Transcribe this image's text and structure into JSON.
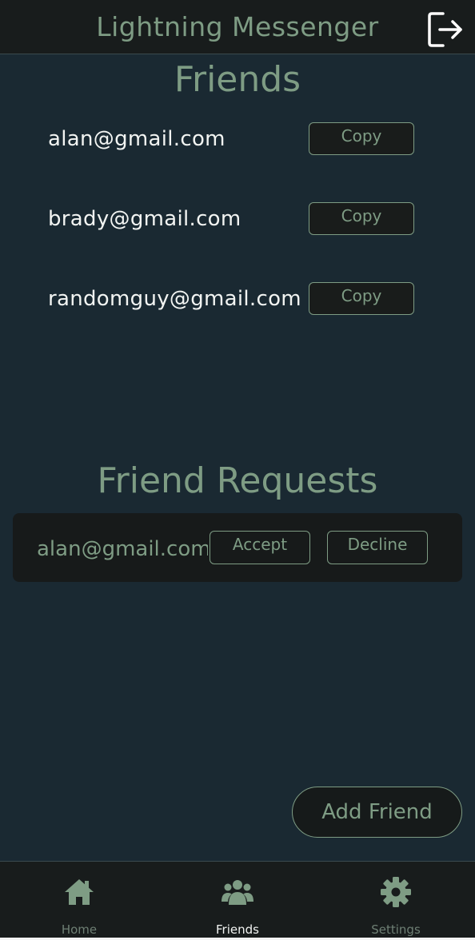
{
  "header": {
    "title": "Lightning Messenger",
    "logout_icon": "logout-icon"
  },
  "friends": {
    "title": "Friends",
    "items": [
      {
        "email": "alan@gmail.com",
        "copy_label": "Copy"
      },
      {
        "email": "brady@gmail.com",
        "copy_label": "Copy"
      },
      {
        "email": "randomguy@gmail.com",
        "copy_label": "Copy"
      }
    ]
  },
  "requests": {
    "title": "Friend Requests",
    "items": [
      {
        "email": "alan@gmail.com",
        "accept_label": "Accept",
        "decline_label": "Decline"
      }
    ]
  },
  "add_friend_label": "Add Friend",
  "tabs": [
    {
      "label": "Home",
      "icon": "home-icon",
      "active": false
    },
    {
      "label": "Friends",
      "icon": "users-icon",
      "active": true
    },
    {
      "label": "Settings",
      "icon": "gear-icon",
      "active": false
    }
  ],
  "colors": {
    "background": "#1a2932",
    "bar": "#181c1c",
    "accent": "#7e9c84",
    "text": "#f2f4f2"
  }
}
